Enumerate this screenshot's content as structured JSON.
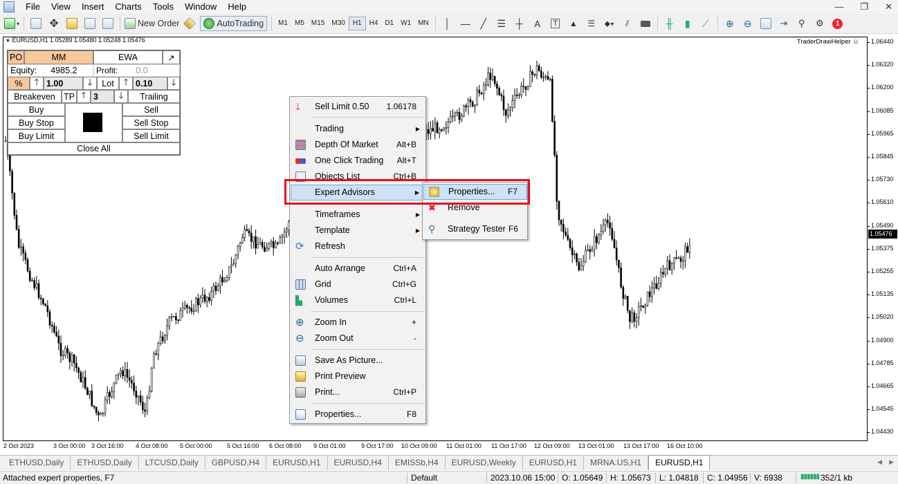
{
  "menubar": {
    "items": [
      "File",
      "View",
      "Insert",
      "Charts",
      "Tools",
      "Window",
      "Help"
    ]
  },
  "toolbar": {
    "new_order": "New Order",
    "autotrading": "AutoTrading",
    "timeframes": [
      "M1",
      "M5",
      "M15",
      "M30",
      "H1",
      "H4",
      "D1",
      "W1",
      "MN"
    ],
    "active_timeframe": "H1",
    "notification_count": "1"
  },
  "chart": {
    "symbol_info": "EURUSD,H1  1.05289 1.05480 1.05248 1.05476",
    "indicator": "TraderDrawHelper ☺",
    "current_price": "1.05476",
    "y_labels": [
      "1.06440",
      "1.06320",
      "1.06200",
      "1.06085",
      "1.05965",
      "1.05845",
      "1.05730",
      "1.05610",
      "1.05490",
      "1.05375",
      "1.05255",
      "1.05135",
      "1.05020",
      "1.04900",
      "1.04785",
      "1.04665",
      "1.04545",
      "1.04430"
    ],
    "x_labels": [
      "2 Oct 2023",
      "3 Oct 00:00",
      "3 Oct 16:00",
      "4 Oct 08:00",
      "5 Oct 00:00",
      "5 Oct 16:00",
      "6 Oct 08:00",
      "9 Oct 01:00",
      "9 Oct 17:00",
      "10 Oct 09:00",
      "11 Oct 01:00",
      "11 Oct 17:00",
      "12 Oct 09:00",
      "13 Oct 01:00",
      "13 Oct 17:00",
      "16 Oct 10:00"
    ]
  },
  "panel": {
    "po": "PO",
    "mm": "MM",
    "ewa": "EWA",
    "expand": "↗",
    "equity_label": "Equity:",
    "equity_value": "4985.2",
    "profit_label": "Profit:",
    "profit_value": "0.0",
    "percent": "%",
    "up": "🡑",
    "down": "🡓",
    "risk_value": "1.00",
    "lot_label": "Lot",
    "lot_value": "0.10",
    "breakeven": "Breakeven",
    "tp": "TP",
    "tp_value": "3",
    "trailing": "Trailing",
    "buy": "Buy",
    "sell": "Sell",
    "buy_stop": "Buy Stop",
    "sell_stop": "Sell Stop",
    "buy_limit": "Buy Limit",
    "sell_limit": "Sell Limit",
    "close_all": "Close All"
  },
  "context_menu": {
    "sell_limit": {
      "label": "Sell Limit 0.50",
      "shortcut": "1.06178"
    },
    "trading": {
      "label": "Trading"
    },
    "depth_of_market": {
      "label": "Depth Of Market",
      "shortcut": "Alt+B"
    },
    "one_click_trading": {
      "label": "One Click Trading",
      "shortcut": "Alt+T"
    },
    "objects_list": {
      "label": "Objects List",
      "shortcut": "Ctrl+B"
    },
    "expert_advisors": {
      "label": "Expert Advisors"
    },
    "timeframes": {
      "label": "Timeframes"
    },
    "template": {
      "label": "Template"
    },
    "refresh": {
      "label": "Refresh"
    },
    "auto_arrange": {
      "label": "Auto Arrange",
      "shortcut": "Ctrl+A"
    },
    "grid": {
      "label": "Grid",
      "shortcut": "Ctrl+G"
    },
    "volumes": {
      "label": "Volumes",
      "shortcut": "Ctrl+L"
    },
    "zoom_in": {
      "label": "Zoom In",
      "shortcut": "+"
    },
    "zoom_out": {
      "label": "Zoom Out",
      "shortcut": "-"
    },
    "save_as_picture": {
      "label": "Save As Picture..."
    },
    "print_preview": {
      "label": "Print Preview"
    },
    "print": {
      "label": "Print...",
      "shortcut": "Ctrl+P"
    },
    "properties": {
      "label": "Properties...",
      "shortcut": "F8"
    }
  },
  "submenu": {
    "properties": {
      "label": "Properties...",
      "shortcut": "F7"
    },
    "remove": {
      "label": "Remove"
    },
    "strategy_tester": {
      "label": "Strategy Tester",
      "shortcut": "F6"
    }
  },
  "tabs": [
    "ETHUSD,Daily",
    "ETHUSD,Daily",
    "LTCUSD,Daily",
    "GBPUSD,H4",
    "EURUSD,H1",
    "EURUSD,H4",
    "EMISSb,H4",
    "EURUSD,Weekly",
    "EURUSD,H1",
    "MRNA.US,H1",
    "EURUSD,H1"
  ],
  "active_tab_index": 10,
  "status": {
    "message": "Attached expert properties, F7",
    "profile": "Default",
    "datetime": "2023.10.06 15:00",
    "open": "O: 1.05649",
    "high": "H: 1.05673",
    "low": "L: 1.04818",
    "close": "C: 1.04956",
    "volume": "V: 6938",
    "traffic": "352/1 kb"
  },
  "colors": {
    "highlight_box": "#e8101a",
    "menu_highlight": "#cde1f7",
    "panel_orange": "#f6c89a"
  }
}
